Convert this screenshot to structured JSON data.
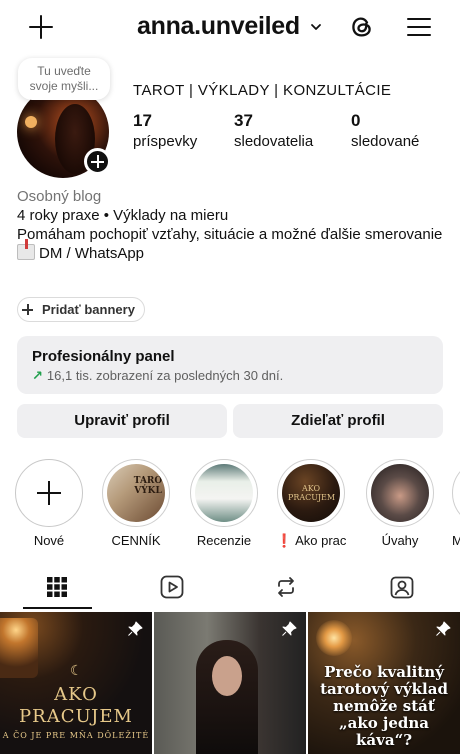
{
  "topbar": {
    "username": "anna.unveiled",
    "icons": {
      "new_post": "plus-icon",
      "account_switch": "chevron-down-icon",
      "threads": "threads-icon",
      "menu": "hamburger-menu-icon"
    }
  },
  "note": {
    "text": "Tu uveďte svoje myšli..."
  },
  "profile": {
    "category_line": "TAROT | VÝKLADY | KONZULTÁCIE",
    "stats": [
      {
        "value": "17",
        "label": "príspevky"
      },
      {
        "value": "37",
        "label": "sledovatelia"
      },
      {
        "value": "0",
        "label": "sledované"
      }
    ]
  },
  "bio": {
    "category": "Osobný blog",
    "line1": "4 roky praxe • Výklady na mieru",
    "line2": "Pomáham pochopiť vzťahy, situácie a možné ďalšie smerovanie",
    "contact": "DM / WhatsApp"
  },
  "banners_button": "Pridať bannery",
  "professional_panel": {
    "title": "Profesionálny panel",
    "stat": "16,1 tis. zobrazení za posledných 30 dní."
  },
  "actions": {
    "edit": "Upraviť profil",
    "share": "Zdieľať profil"
  },
  "highlights": [
    {
      "label": "Nové"
    },
    {
      "label": "CENNÍK"
    },
    {
      "label": "Recenzie"
    },
    {
      "label": "❗ Ako prac..."
    },
    {
      "label": "Úvahy"
    },
    {
      "label": "M"
    }
  ],
  "highlight_art": {
    "cennik": "TARO VÝKL",
    "ako": "AKO PRACUJEM"
  },
  "tabs": [
    {
      "icon": "grid-icon",
      "active": true
    },
    {
      "icon": "reels-icon",
      "active": false
    },
    {
      "icon": "reposts-icon",
      "active": false
    },
    {
      "icon": "tagged-icon",
      "active": false
    }
  ],
  "posts": [
    {
      "title": "AKO PRACUJEM",
      "subtitle": "A ČO JE PRE MŇA DÔLEŽITÉ",
      "pinned": true
    },
    {
      "title": "",
      "pinned": true
    },
    {
      "title": "Prečo kvalitný tarotový výklad nemôže stáť „ako jedna káva“?",
      "pinned": true
    }
  ]
}
